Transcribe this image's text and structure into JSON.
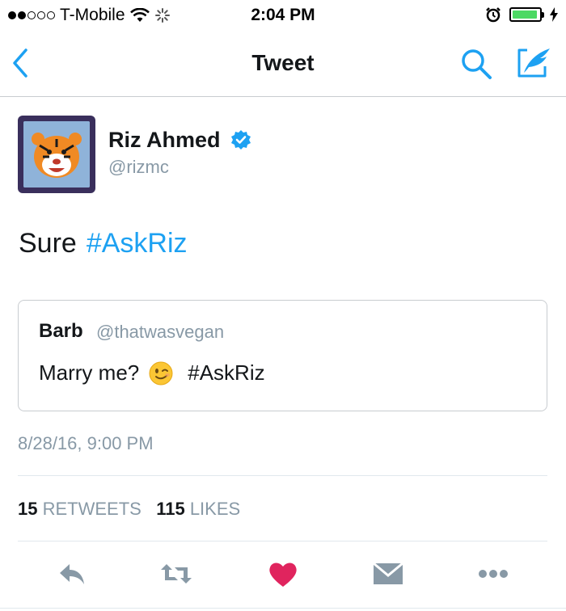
{
  "status_bar": {
    "carrier": "T-Mobile",
    "time": "2:04 PM",
    "battery_level": 0.95,
    "accent_battery": "#4cd964"
  },
  "nav": {
    "title": "Tweet",
    "back_icon": "chevron-left-icon",
    "search_icon": "search-icon",
    "compose_icon": "compose-tweet-icon",
    "accent": "#1da1f2"
  },
  "tweet": {
    "author_name": "Riz Ahmed",
    "author_handle": "@rizmc",
    "verified": true,
    "text": "Sure",
    "hashtag": "#AskRiz",
    "timestamp": "8/28/16, 9:00 PM",
    "retweets_count": "15",
    "retweets_label": "RETWEETS",
    "likes_count": "115",
    "likes_label": "LIKES"
  },
  "quote": {
    "author_name": "Barb",
    "author_handle": "@thatwasvegan",
    "text": "Marry me?",
    "emoji": "winking-face-emoji",
    "hashtag": "#AskRiz"
  },
  "actions": {
    "reply_icon": "reply-icon",
    "retweet_icon": "retweet-icon",
    "like_icon": "heart-icon",
    "message_icon": "direct-message-icon",
    "more_icon": "more-icon",
    "like_color": "#e0245e",
    "icon_color": "#8899a6"
  }
}
